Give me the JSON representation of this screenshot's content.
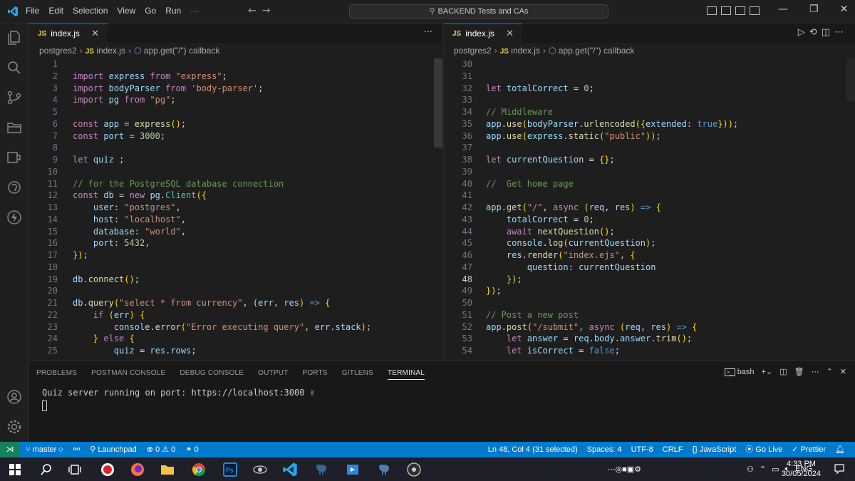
{
  "window": {
    "menu": [
      "File",
      "Edit",
      "Selection",
      "View",
      "Go",
      "Run"
    ],
    "menu_more": "···",
    "search_text": "BACKEND Tests and CAs"
  },
  "left_editor": {
    "tab_label": "index.js",
    "tab_lang": "JS",
    "breadcrumb": [
      "postgres2",
      "index.js",
      "app.get(\"/\") callback"
    ],
    "more": "···"
  },
  "right_editor": {
    "tab_label": "index.js",
    "tab_lang": "JS",
    "breadcrumb": [
      "postgres2",
      "index.js",
      "app.get(\"/\") callback"
    ]
  },
  "left_code": [
    {
      "n": "1",
      "t": ""
    },
    {
      "n": "2",
      "t": "import express from \"express\";"
    },
    {
      "n": "3",
      "t": "import bodyParser from 'body-parser';"
    },
    {
      "n": "4",
      "t": "import pg from \"pg\";"
    },
    {
      "n": "5",
      "t": ""
    },
    {
      "n": "6",
      "t": "const app = express();"
    },
    {
      "n": "7",
      "t": "const port = 3000;"
    },
    {
      "n": "8",
      "t": ""
    },
    {
      "n": "9",
      "t": "let quiz ;"
    },
    {
      "n": "10",
      "t": ""
    },
    {
      "n": "11",
      "t": "// for the PostgreSQL database connection"
    },
    {
      "n": "12",
      "t": "const db = new pg.Client({"
    },
    {
      "n": "13",
      "t": "    user: \"postgres\","
    },
    {
      "n": "14",
      "t": "    host: \"localhost\","
    },
    {
      "n": "15",
      "t": "    database: \"world\","
    },
    {
      "n": "16",
      "t": "    port: 5432,"
    },
    {
      "n": "17",
      "t": "});"
    },
    {
      "n": "18",
      "t": ""
    },
    {
      "n": "19",
      "t": "db.connect();"
    },
    {
      "n": "20",
      "t": ""
    },
    {
      "n": "21",
      "t": "db.query(\"select * from currency\", (err, res) => {"
    },
    {
      "n": "22",
      "t": "    if (err) {"
    },
    {
      "n": "23",
      "t": "        console.error(\"Error executing query\", err.stack);"
    },
    {
      "n": "24",
      "t": "    } else {"
    },
    {
      "n": "25",
      "t": "        quiz = res.rows;"
    }
  ],
  "right_code": [
    {
      "n": "30",
      "t": ""
    },
    {
      "n": "31",
      "t": ""
    },
    {
      "n": "32",
      "t": "let totalCorrect = 0;"
    },
    {
      "n": "33",
      "t": ""
    },
    {
      "n": "34",
      "t": "// Middleware"
    },
    {
      "n": "35",
      "t": "app.use(bodyParser.urlencoded({extended: true}));"
    },
    {
      "n": "36",
      "t": "app.use(express.static(\"public\"));"
    },
    {
      "n": "37",
      "t": ""
    },
    {
      "n": "38",
      "t": "let currentQuestion = {};"
    },
    {
      "n": "39",
      "t": ""
    },
    {
      "n": "40",
      "t": "//  Get home page"
    },
    {
      "n": "41",
      "t": ""
    },
    {
      "n": "42",
      "t": "app.get(\"/\", async (req, res) => {"
    },
    {
      "n": "43",
      "t": "    totalCorrect = 0;"
    },
    {
      "n": "44",
      "t": "    await nextQuestion();"
    },
    {
      "n": "45",
      "t": "    console.log(currentQuestion);"
    },
    {
      "n": "46",
      "t": "    res.render(\"index.ejs\", {"
    },
    {
      "n": "47",
      "t": "        question: currentQuestion"
    },
    {
      "n": "48",
      "t": "    });"
    },
    {
      "n": "49",
      "t": "});"
    },
    {
      "n": "50",
      "t": ""
    },
    {
      "n": "51",
      "t": "// Post a new post"
    },
    {
      "n": "52",
      "t": "app.post(\"/submit\", async (req, res) => {"
    },
    {
      "n": "53",
      "t": "    let answer = req.body.answer.trim();"
    },
    {
      "n": "54",
      "t": "    let isCorrect = false;"
    }
  ],
  "panel": {
    "tabs": [
      "PROBLEMS",
      "POSTMAN CONSOLE",
      "DEBUG CONSOLE",
      "OUTPUT",
      "PORTS",
      "GITLENS",
      "TERMINAL"
    ],
    "active_tab": "TERMINAL",
    "shell": "bash",
    "terminal_line": "Quiz server running on port:  https://localhost:3000 ✌"
  },
  "status": {
    "branch": "master",
    "launchpad": "Launchpad",
    "errors": "0",
    "warnings": "0",
    "ports": "0",
    "position": "Ln 48, Col 4 (31 selected)",
    "spaces": "Spaces: 4",
    "encoding": "UTF-8",
    "eol": "CRLF",
    "language": "JavaScript",
    "golive": "Go Live",
    "prettier": "Prettier"
  },
  "taskbar": {
    "lang": "ENG",
    "time": "4:33 PM",
    "date": "30/05/2024"
  },
  "colors": {
    "statusbar": "#007acc",
    "editor_bg": "#1e1e1e",
    "selection": "#264f78"
  }
}
